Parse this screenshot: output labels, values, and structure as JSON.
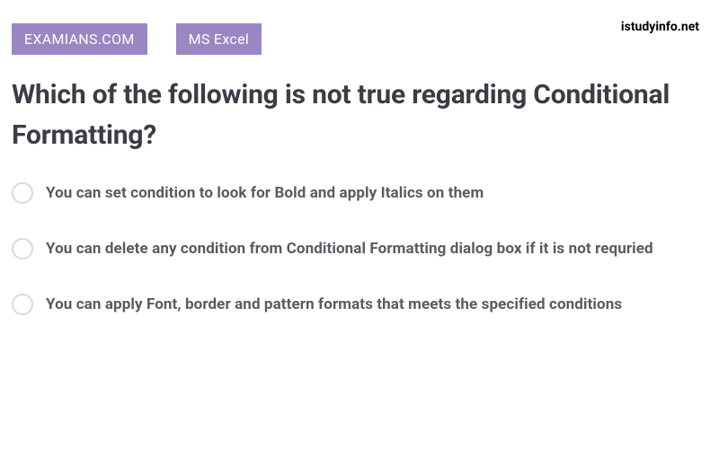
{
  "watermark": "istudyinfo.net",
  "tags": {
    "site": "EXAMIANS.COM",
    "category": "MS Excel"
  },
  "question": "Which of the following is not true regarding Conditional Formatting?",
  "options": [
    "You can set condition to look for Bold and apply Italics on them",
    "You can delete any condition from Conditional Formatting dialog box if it is not requried",
    "You can apply Font, border and pattern formats that meets the specified conditions"
  ]
}
